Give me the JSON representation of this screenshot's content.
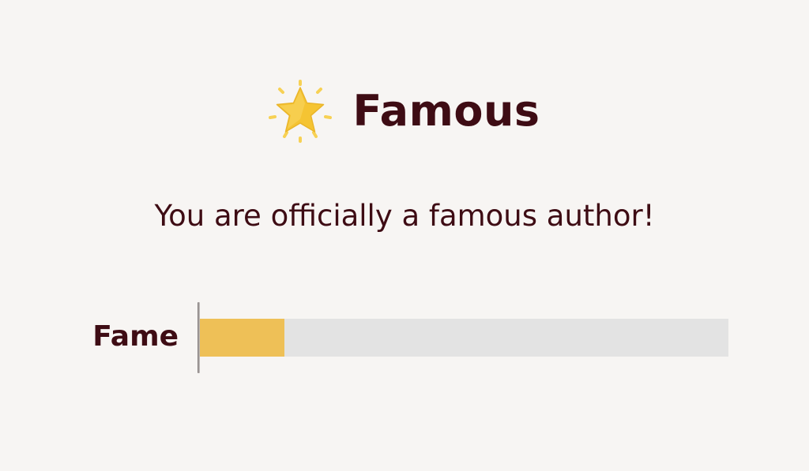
{
  "achievement": {
    "icon": "glowing-star-icon",
    "title": "Famous",
    "message": "You are officially a famous author!"
  },
  "stat": {
    "label": "Fame",
    "level": 0.16
  },
  "colors": {
    "background": "#f7f5f3",
    "text": "#3e0c14",
    "bar_fill": "#eec057",
    "bar_track": "#e3e3e3",
    "star": "#f5c433"
  }
}
